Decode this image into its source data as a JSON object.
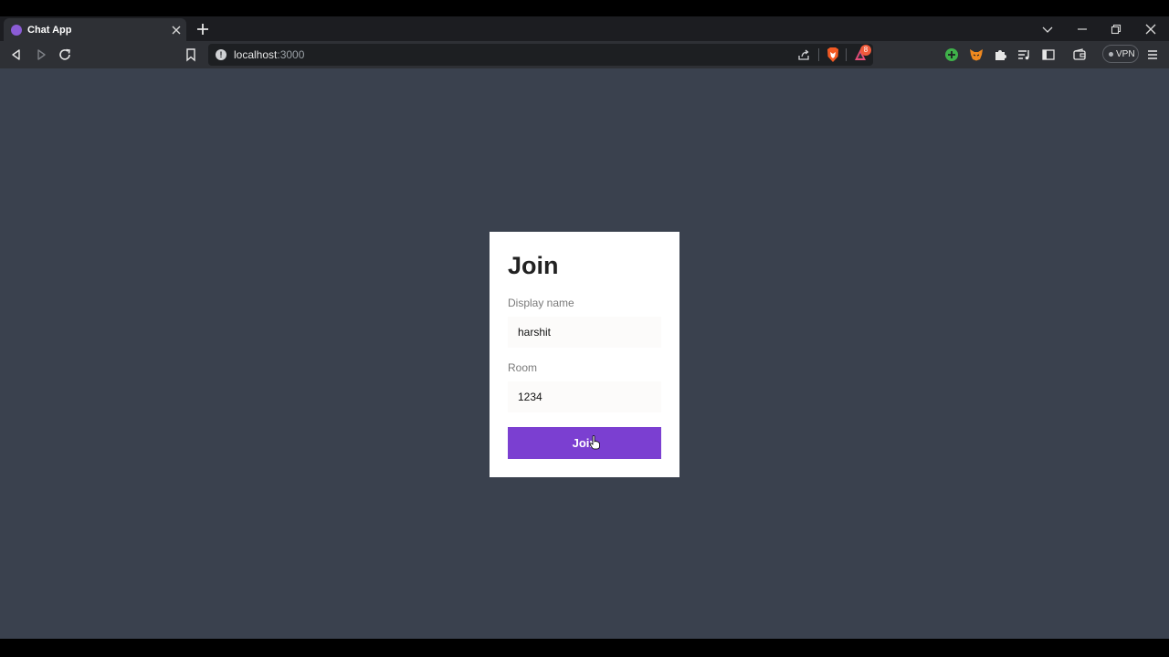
{
  "browser": {
    "tab": {
      "title": "Chat App",
      "favicon_color": "#8b5cd6",
      "favicon_icon": "purple-circle"
    },
    "address": {
      "host": "localhost",
      "port": ":3000"
    },
    "rewards_badge_count": "8",
    "vpn_label": "VPN"
  },
  "page": {
    "background": "#3a414e",
    "join_form": {
      "heading": "Join",
      "display_name_label": "Display name",
      "display_name_value": "harshit",
      "room_label": "Room",
      "room_value": "1234",
      "button_label": "Join",
      "button_color": "#7b3fd1"
    }
  }
}
